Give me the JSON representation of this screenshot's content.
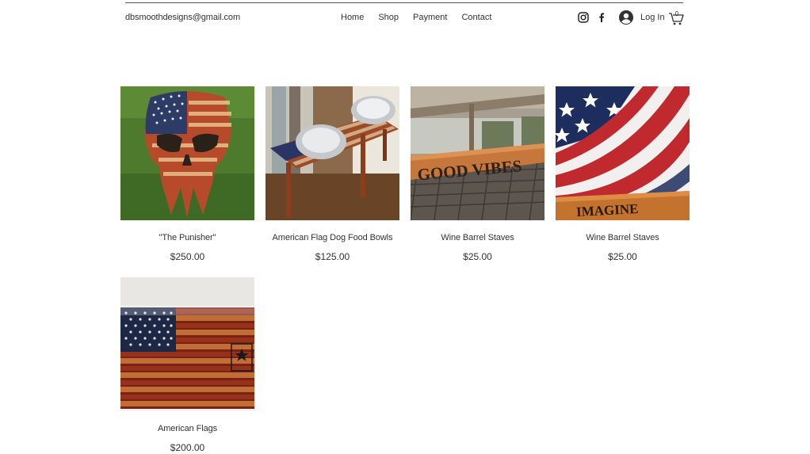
{
  "header": {
    "email": "dbsmoothdesigns@gmail.com",
    "nav": [
      "Home",
      "Shop",
      "Payment",
      "Contact"
    ],
    "login_label": "Log In",
    "cart_count": "0"
  },
  "products": [
    {
      "name": "\"The Punisher\"",
      "price": "$250.00"
    },
    {
      "name": "American Flag Dog Food Bowls",
      "price": "$125.00"
    },
    {
      "name": "Wine Barrel Staves",
      "price": "$25.00",
      "image_text": "GOOD VIBES"
    },
    {
      "name": "Wine Barrel Staves",
      "price": "$25.00",
      "image_text": "IMAGINE"
    },
    {
      "name": "American Flags",
      "price": "$200.00"
    }
  ],
  "colors": {
    "text": "#333333",
    "flag_red": "#b8322a",
    "flag_blue": "#1d2d5e",
    "wood": "#c8762f"
  }
}
